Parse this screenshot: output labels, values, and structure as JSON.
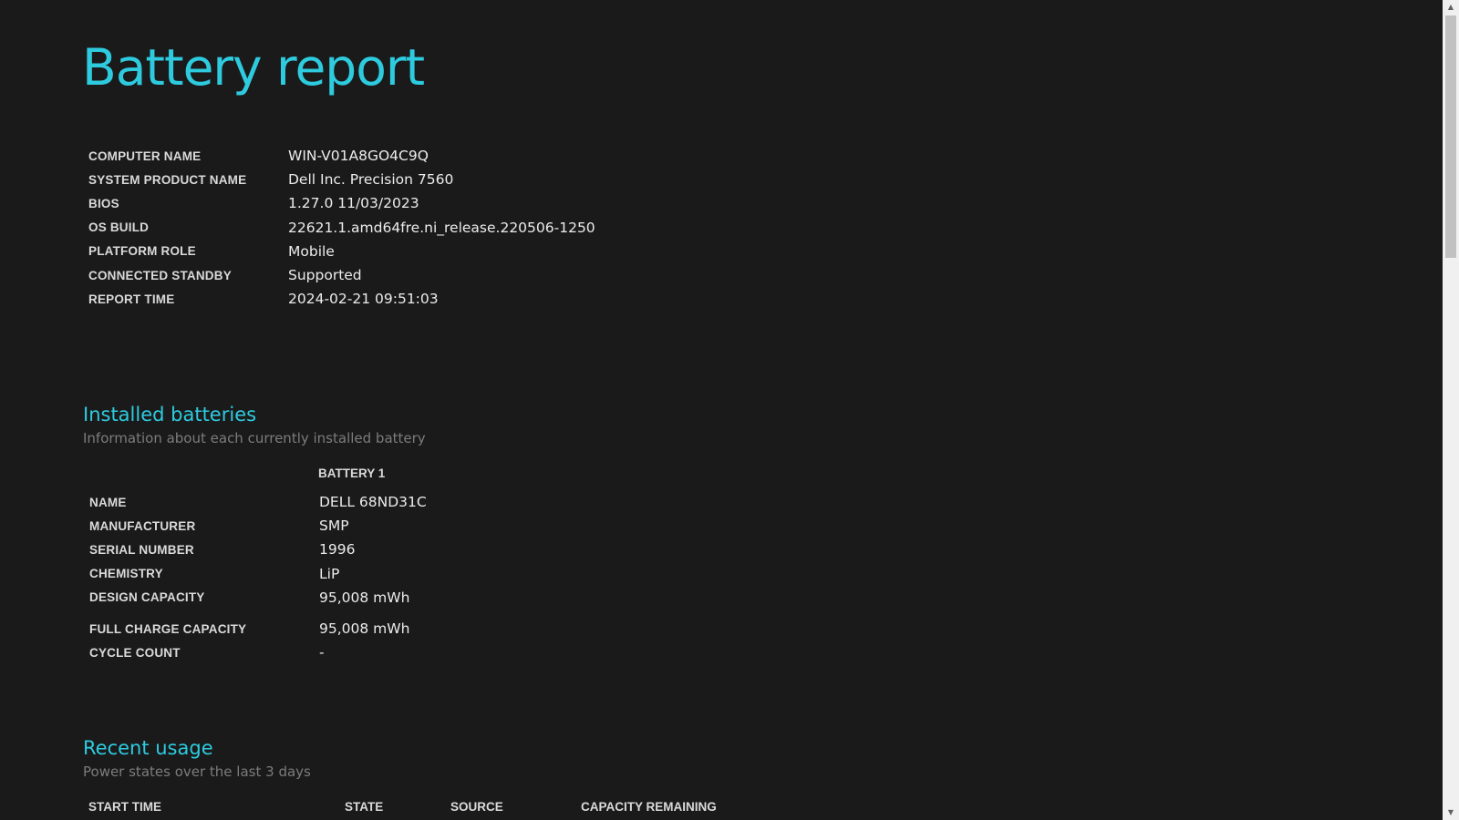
{
  "report": {
    "title": "Battery report"
  },
  "system_info": [
    {
      "label": "COMPUTER NAME",
      "value": "WIN-V01A8GO4C9Q"
    },
    {
      "label": "SYSTEM PRODUCT NAME",
      "value": "Dell Inc. Precision 7560"
    },
    {
      "label": "BIOS",
      "value": "1.27.0 11/03/2023"
    },
    {
      "label": "OS BUILD",
      "value": "22621.1.amd64fre.ni_release.220506-1250"
    },
    {
      "label": "PLATFORM ROLE",
      "value": "Mobile"
    },
    {
      "label": "CONNECTED STANDBY",
      "value": "Supported"
    },
    {
      "label": "REPORT TIME",
      "value": "2024-02-21  09:51:03"
    }
  ],
  "installed_batteries": {
    "title": "Installed batteries",
    "subtitle": "Information about each currently installed battery",
    "column_header": "BATTERY 1",
    "rows": [
      {
        "label": "NAME",
        "value": "DELL 68ND31C"
      },
      {
        "label": "MANUFACTURER",
        "value": "SMP"
      },
      {
        "label": "SERIAL NUMBER",
        "value": "1996"
      },
      {
        "label": "CHEMISTRY",
        "value": "LiP"
      },
      {
        "label": "DESIGN CAPACITY",
        "value": "95,008 mWh"
      },
      {
        "label": "FULL CHARGE CAPACITY",
        "value": "95,008 mWh"
      },
      {
        "label": "CYCLE COUNT",
        "value": "-"
      }
    ]
  },
  "recent_usage": {
    "title": "Recent usage",
    "subtitle": "Power states over the last 3 days",
    "columns": [
      "START TIME",
      "STATE",
      "SOURCE",
      "CAPACITY REMAINING"
    ]
  },
  "scrollbar": {
    "up_icon": "scroll-up-arrow-icon",
    "down_icon": "scroll-down-arrow-icon"
  }
}
